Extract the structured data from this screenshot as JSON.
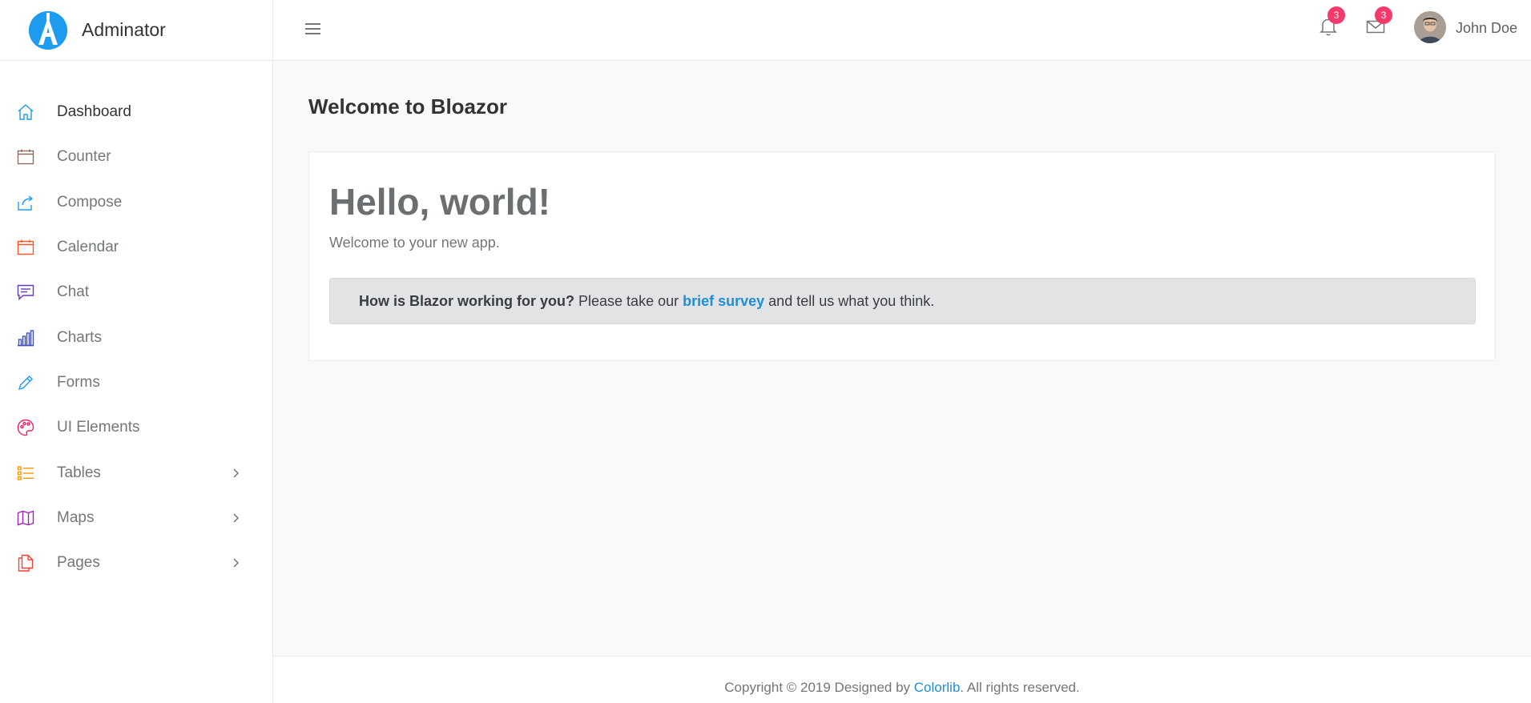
{
  "brand": {
    "name": "Adminator",
    "logo_letter": "A",
    "logo_color": "#1d9cf0"
  },
  "sidebar": {
    "items": [
      {
        "label": "Dashboard",
        "icon": "home-icon",
        "color": "#1d9cf0",
        "active": true
      },
      {
        "label": "Counter",
        "icon": "calendar-icon",
        "color": "#8d6e63"
      },
      {
        "label": "Compose",
        "icon": "share-icon",
        "color": "#1d9cf0"
      },
      {
        "label": "Calendar",
        "icon": "calendar-icon",
        "color": "#ff5722"
      },
      {
        "label": "Chat",
        "icon": "chat-icon",
        "color": "#673ab7"
      },
      {
        "label": "Charts",
        "icon": "bar-chart-icon",
        "color": "#3f51b5"
      },
      {
        "label": "Forms",
        "icon": "pencil-icon",
        "color": "#1d9cf0"
      },
      {
        "label": "UI Elements",
        "icon": "palette-icon",
        "color": "#e91e63"
      },
      {
        "label": "Tables",
        "icon": "list-icon",
        "color": "#ff9800",
        "has_submenu": true
      },
      {
        "label": "Maps",
        "icon": "map-icon",
        "color": "#9c27b0",
        "has_submenu": true
      },
      {
        "label": "Pages",
        "icon": "files-icon",
        "color": "#f44336",
        "has_submenu": true
      }
    ]
  },
  "header": {
    "notifications_count": "3",
    "messages_count": "3",
    "user_name": "John Doe"
  },
  "main": {
    "page_title": "Welcome to Bloazor",
    "hello": "Hello, world!",
    "welcome_text": "Welcome to your new app.",
    "survey": {
      "question": "How is Blazor working for you?",
      "before_link": " Please take our ",
      "link_text": "brief survey",
      "after_link": " and tell us what you think."
    }
  },
  "footer": {
    "prefix": "Copyright © 2019 Designed by ",
    "link_text": "Colorlib",
    "suffix": ". All rights reserved."
  }
}
